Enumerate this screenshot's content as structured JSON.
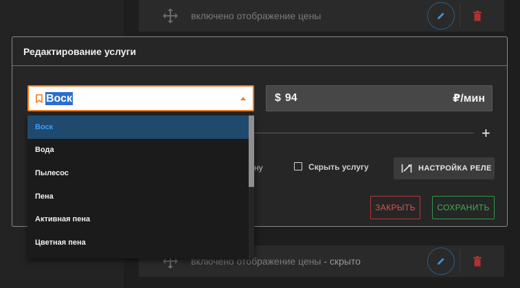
{
  "background": {
    "top_row": {
      "text": "включено отображение цены"
    },
    "bottom_row": {
      "text": "включено отображение цены",
      "suffix": " - скрыто"
    },
    "icons": {
      "move": "move-arrows-icon",
      "edit": "pencil-icon",
      "delete": "trash-icon"
    }
  },
  "modal": {
    "title": "Редактирование услуги",
    "service": {
      "value": "Воск",
      "icon": "bookmark-icon"
    },
    "price": {
      "currency": "$",
      "value": "94",
      "unit": "₽/мин"
    },
    "add_icon": "+",
    "partial_label": "ну",
    "hide_service_label": "Скрыть услугу",
    "hide_service_checked": false,
    "relay_button": {
      "label": "НАСТРОЙКА РЕЛЕ",
      "icon": "relay-icon"
    },
    "close_button": "ЗАКРЫТЬ",
    "save_button": "СОХРАНИТЬ"
  },
  "dropdown": {
    "options": [
      "Воск",
      "Вода",
      "Пылесос",
      "Пена",
      "Активная пена",
      "Цветная пена"
    ],
    "selected": "Воск"
  },
  "colors": {
    "accent_orange": "#ee7b20",
    "selected_bg": "#1f4a6d",
    "selected_text": "#3a9ff2",
    "close": "#e25151",
    "save": "#3db356",
    "header_line": "#8a7526"
  }
}
